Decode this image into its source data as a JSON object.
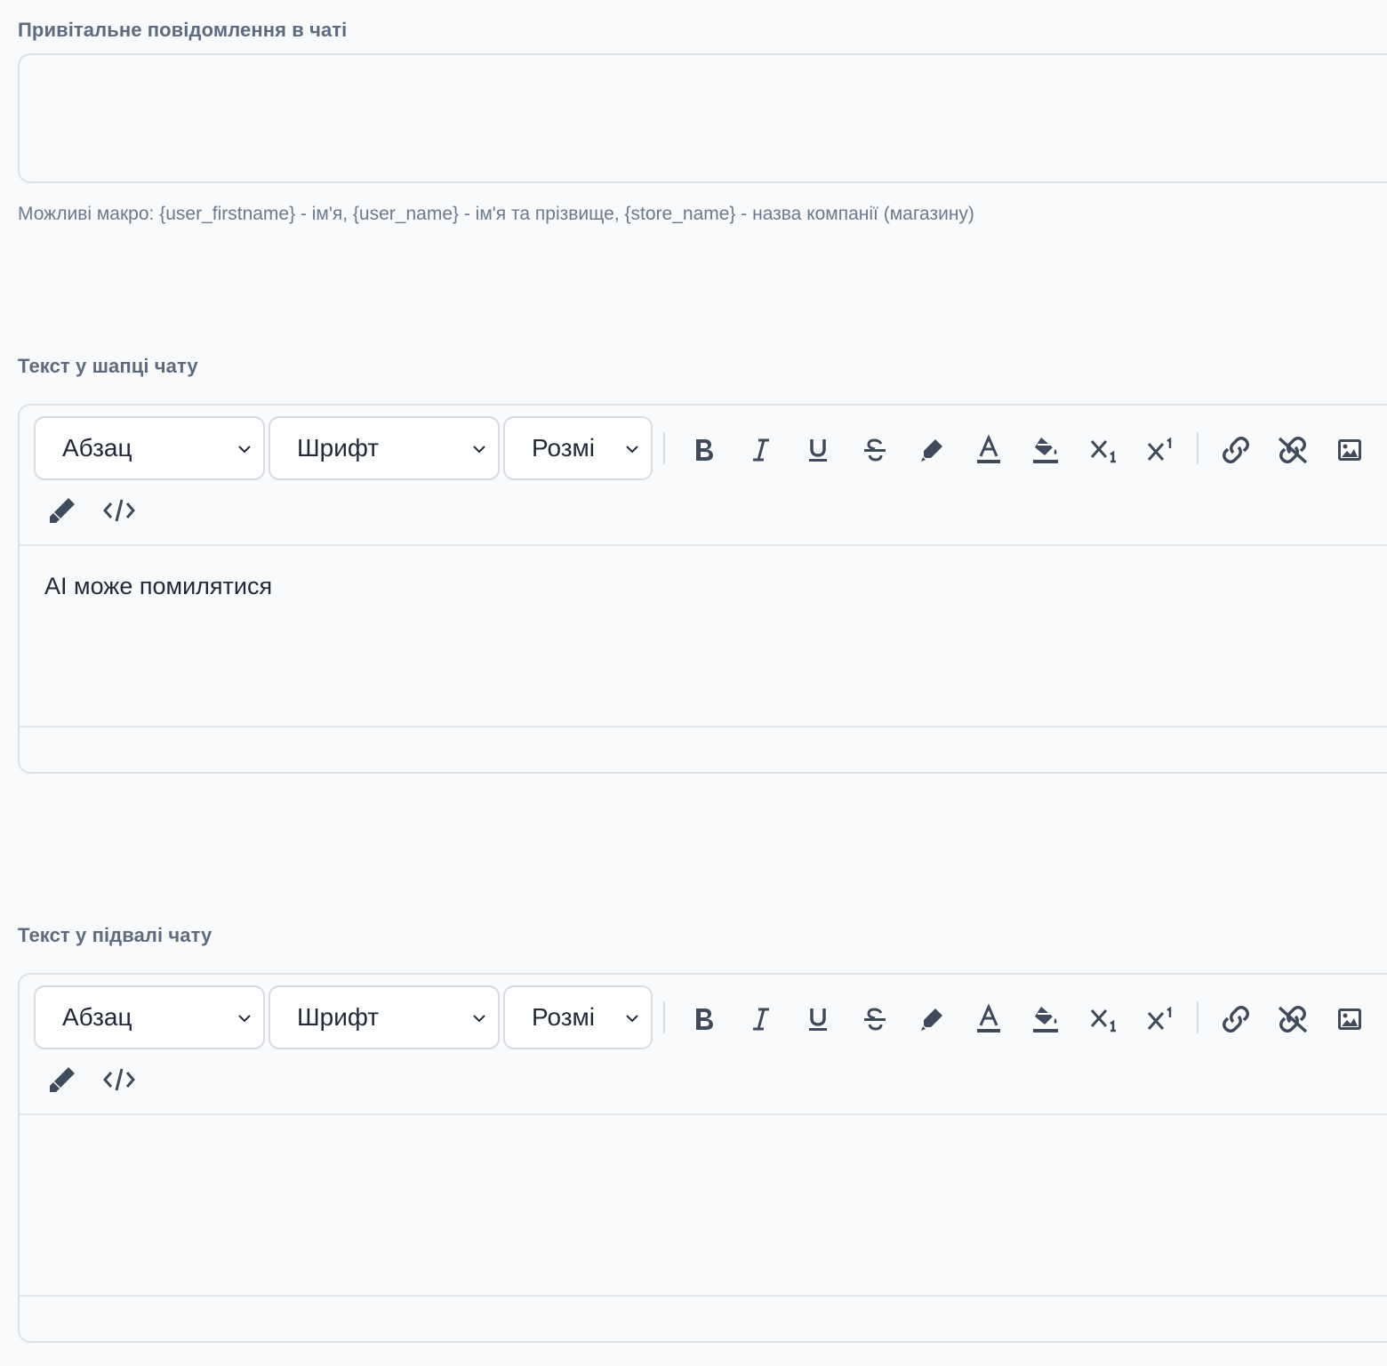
{
  "welcome": {
    "label": "Привітальне повідомлення в чаті",
    "value": "",
    "hint": "Можливі макро: {user_firstname} - ім'я, {user_name} - ім'я та прізвище, {store_name} - назва компанії (магазину)"
  },
  "header_editor": {
    "label": "Текст у шапці чату",
    "block_format": "Абзац",
    "font": "Шрифт",
    "size": "Розмі",
    "content": "AI може помилятися"
  },
  "footer_editor": {
    "label": "Текст у підвалі чату",
    "block_format": "Абзац",
    "font": "Шрифт",
    "size": "Розмі",
    "content": ""
  },
  "toolbar_icons": [
    "bold-icon",
    "italic-icon",
    "underline-icon",
    "strikethrough-icon",
    "highlighter-icon",
    "font-color-icon",
    "background-color-icon",
    "subscript-icon",
    "superscript-icon",
    "link-icon",
    "unlink-icon",
    "image-icon",
    "clear-format-icon",
    "code-view-icon"
  ],
  "colors": {
    "label": "#5c6b80",
    "border": "#dde2e8",
    "icon": "#3f4a5a",
    "background": "#f8fafc"
  }
}
